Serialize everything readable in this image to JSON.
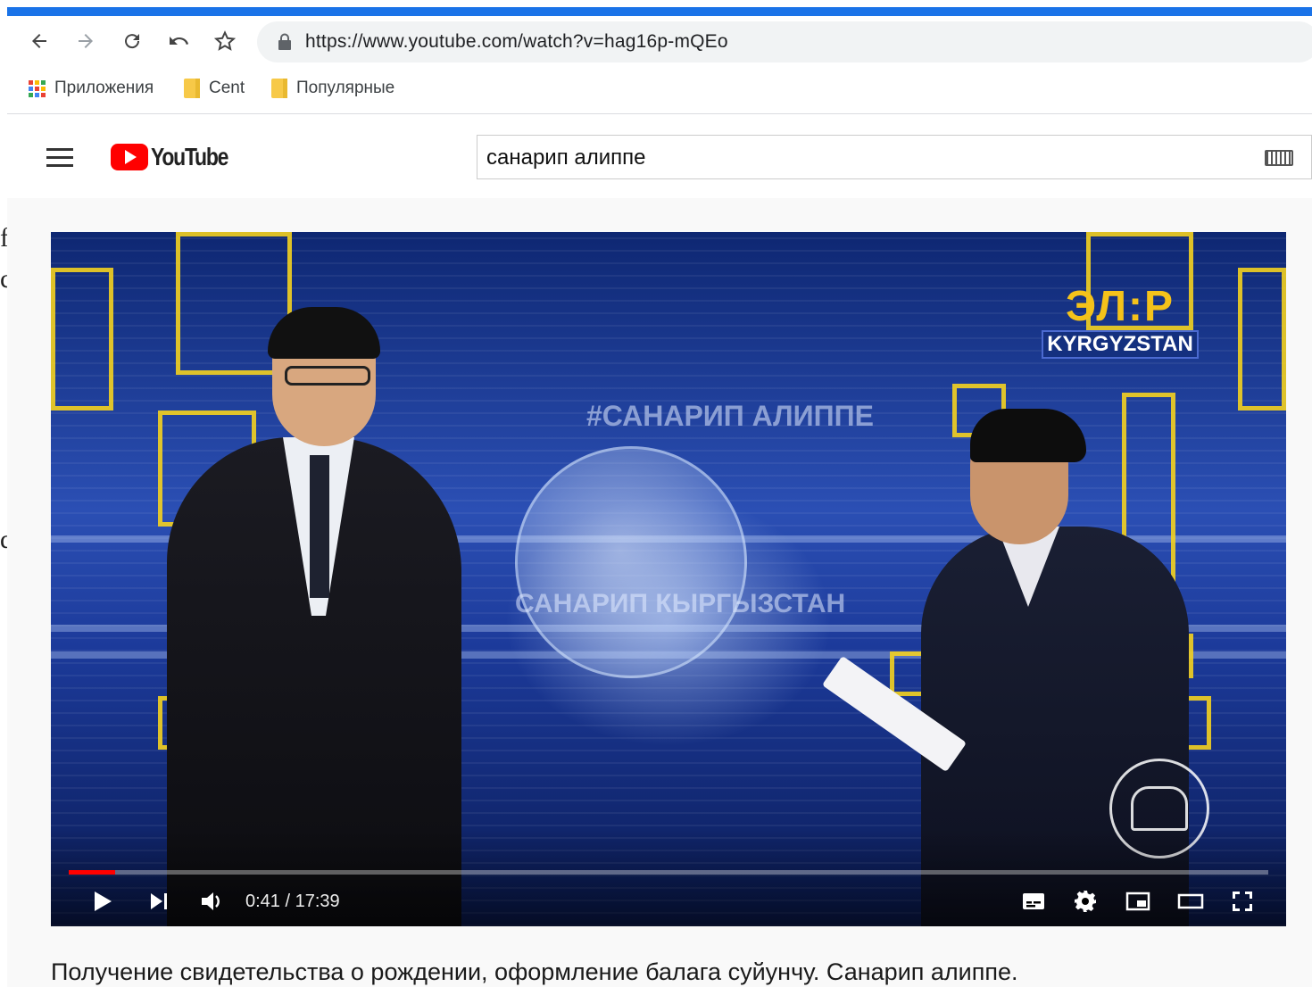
{
  "browser": {
    "url": "https://www.youtube.com/watch?v=hag16p-mQEo",
    "bookmarks": [
      {
        "label": "Приложения",
        "icon": "apps-icon"
      },
      {
        "label": "Cent",
        "icon": "folder-icon"
      },
      {
        "label": "Популярные",
        "icon": "folder-icon"
      }
    ],
    "accent_color": "#1a73e8"
  },
  "youtube": {
    "logo_text": "YouTube",
    "search_value": "санарип алиппе"
  },
  "player": {
    "overlay_text_1": "#САНАРИП АЛИППЕ",
    "overlay_text_2": "САНАРИП КЫРГЫЗСТАН",
    "channel_mark": "ЭЛ:Р",
    "channel_sub": "KYRGYZSTAN",
    "time_display": "0:41 / 17:39",
    "progress_fraction": 0.039,
    "progress_color": "#ff0000"
  },
  "video": {
    "title": "Получение свидетельства о рождении, оформление балага суйунчу. Санарип алиппе."
  },
  "edge_fragments": [
    "f",
    "c",
    "d"
  ]
}
